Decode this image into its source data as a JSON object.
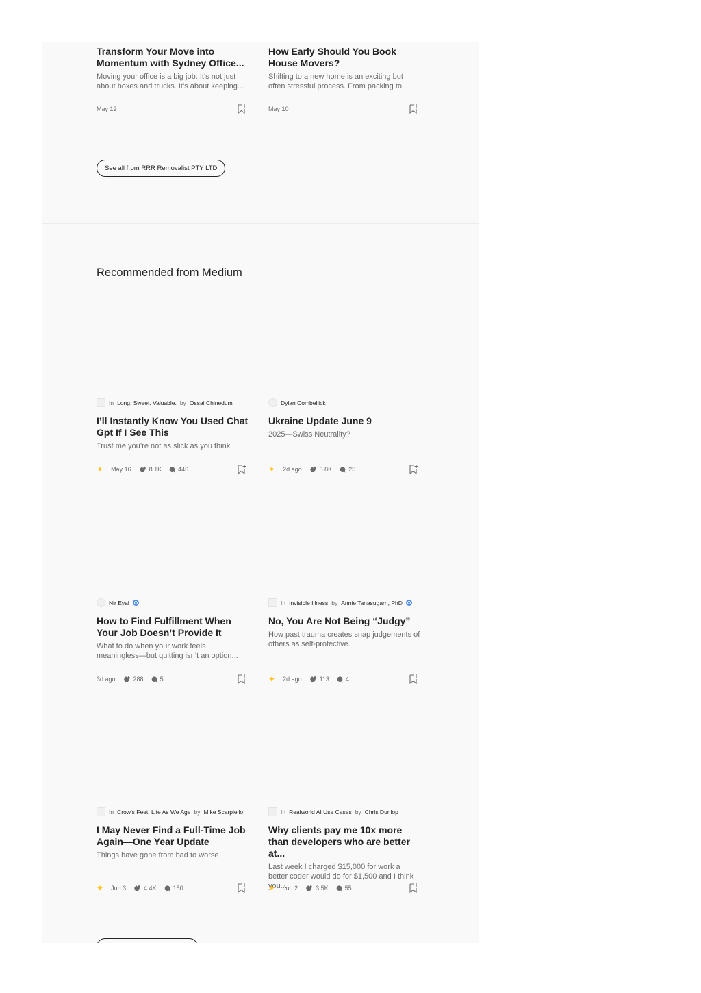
{
  "top_cards": [
    {
      "title": "Transform Your Move into Momentum with Sydney Office...",
      "subtitle": "Moving your office is a big job. It’s not just about boxes and trucks. It’s about keeping...",
      "date": "May 12"
    },
    {
      "title": "How Early Should You Book House Movers?",
      "subtitle": "Shifting to a new home is an exciting but often stressful process. From packing to...",
      "date": "May 10"
    }
  ],
  "see_all_label": "See all from RRR Removalist PTY LTD",
  "recommended_heading": "Recommended from Medium",
  "labels": {
    "in": "In",
    "by": "by"
  },
  "recommended": [
    {
      "publication": "Long. Sweet. Valuable.",
      "author": "Ossai Chinedum",
      "title": "I’ll Instantly Know You Used Chat Gpt If I See This",
      "subtitle": "Trust me you’re not as slick as you think",
      "date": "May 16",
      "claps": "8.1K",
      "comments": "446",
      "starred": true
    },
    {
      "publication": "",
      "author": "Dylan Combellick",
      "title": "Ukraine Update June 9",
      "subtitle": "2025—Swiss Neutrality?",
      "date": "2d ago",
      "claps": "5.8K",
      "comments": "25",
      "starred": true
    },
    {
      "publication": "",
      "author": "Nir Eyal",
      "verified": true,
      "title": "How to Find Fulfillment When Your Job Doesn’t Provide It",
      "subtitle": "What to do when your work feels meaningless—but quitting isn’t an option...",
      "date": "3d ago",
      "claps": "288",
      "comments": "5",
      "starred": false
    },
    {
      "publication": "Invisible Illness",
      "author": "Annie Tanasugarn, PhD",
      "verified": true,
      "title": "No, You Are Not Being “Judgy”",
      "subtitle": "How past trauma creates snap judgements of others as self-protective.",
      "date": "2d ago",
      "claps": "113",
      "comments": "4",
      "starred": true
    },
    {
      "publication": "Crow’s Feet: Life As We Age",
      "author": "Mike Scarpiello",
      "title": "I May Never Find a Full-Time Job Again—One Year Update",
      "subtitle": "Things have gone from bad to worse",
      "date": "Jun 3",
      "claps": "4.4K",
      "comments": "150",
      "starred": true
    },
    {
      "publication": "Realworld AI Use Cases",
      "author": "Chris Dunlop",
      "title": "Why clients pay me 10x more than developers who are better at...",
      "subtitle": "Last week I charged $15,000 for work a better coder would do for $1,500 and I think you...",
      "date": "Jun 2",
      "claps": "3.5K",
      "comments": "55",
      "starred": true
    }
  ],
  "colors": {
    "panel_bg": "#f9f9f9",
    "star": "#ffc017",
    "verified": "#4b8de6",
    "text": "#242424",
    "muted": "#6b6b6b"
  }
}
